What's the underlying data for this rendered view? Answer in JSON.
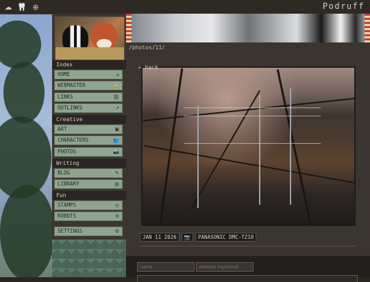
{
  "topbar": {
    "brand": "Podruff",
    "icons": [
      "cloud-moon-icon",
      "tooth-icon",
      "target-icon"
    ]
  },
  "sidebar": {
    "avatar": "avatar",
    "sections": [
      {
        "title": "Index",
        "items": [
          {
            "label": "HOME",
            "icon": "home-icon"
          },
          {
            "label": "WEBMASTER",
            "icon": "lock-icon"
          },
          {
            "label": "LINKS",
            "icon": "link-icon"
          },
          {
            "label": "OUTLINKS",
            "icon": "external-link-icon"
          }
        ]
      },
      {
        "title": "Creative",
        "items": [
          {
            "label": "ART",
            "icon": "image-icon"
          },
          {
            "label": "CHARACTERS",
            "icon": "users-icon"
          },
          {
            "label": "PHOTOS",
            "icon": "camera-icon"
          }
        ]
      },
      {
        "title": "Writing",
        "items": [
          {
            "label": "BLOG",
            "icon": "blog-icon"
          },
          {
            "label": "LIBRARY",
            "icon": "book-icon"
          }
        ]
      },
      {
        "title": "Fun",
        "items": [
          {
            "label": "STAMPS",
            "icon": "stamp-icon"
          },
          {
            "label": "ROBOTS",
            "icon": "robot-icon"
          }
        ]
      }
    ],
    "settings": {
      "label": "SETTINGS",
      "icon": "gear-icon"
    }
  },
  "main": {
    "path": "/photos/11/",
    "back": "← back",
    "photo_date": "JAN 11 2026",
    "camera_model": "PANASONIC DMC-TZ18",
    "comment_form": {
      "name_placeholder": "name",
      "website_placeholder": "website (optional)"
    }
  },
  "colors": {
    "nav_button_bg": "#8fa58f",
    "sidebar_bg": "#3d3630",
    "main_bg": "#3b3530",
    "topbar_bg": "#2f2923"
  }
}
